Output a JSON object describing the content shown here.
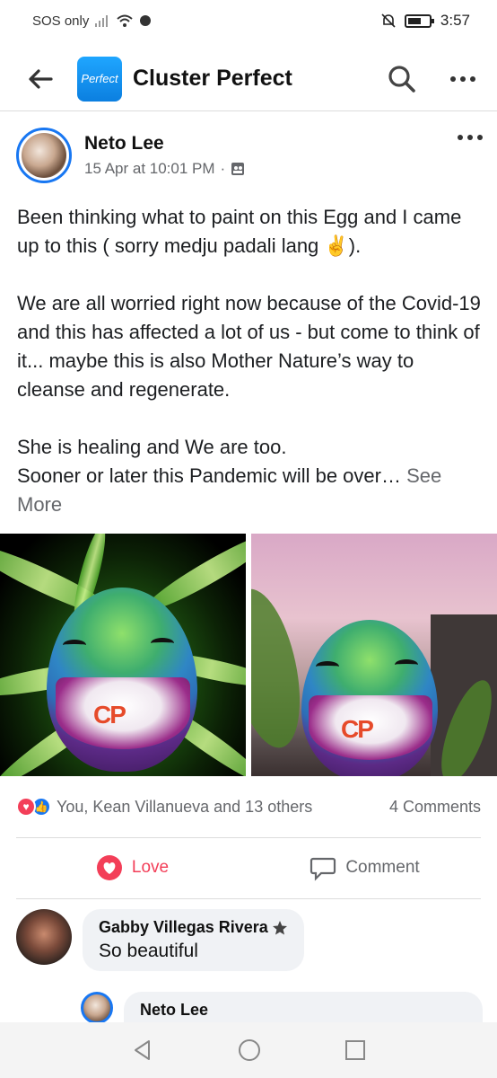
{
  "status_bar": {
    "carrier": "SOS only",
    "time": "3:57"
  },
  "app_bar": {
    "group_logo_text": "Perfect",
    "title": "Cluster Perfect"
  },
  "post": {
    "author": "Neto Lee",
    "timestamp": "15 Apr at 10:01 PM",
    "separator": "·",
    "paragraphs": [
      "Been thinking what to paint on this Egg and I came up to this ( sorry medju padali lang ✌️).",
      "We are all worried right now because of the Covid-19 and this has affected a lot of us - but come to think of it... maybe this is also Mother Nature’s way to cleanse and regenerate.",
      "She is healing and We are too.",
      "Sooner or later this Pandemic will be over…"
    ],
    "see_more": "See More",
    "photo_text": "CP"
  },
  "reactions": {
    "summary": "You, Kean Villanueva and 13 others",
    "comment_count": "4 Comments"
  },
  "actions": {
    "love_label": "Love",
    "comment_label": "Comment"
  },
  "comments": [
    {
      "author": "Gabby Villegas Rivera",
      "text": "So beautiful"
    },
    {
      "author": "Neto Lee",
      "text": ""
    }
  ],
  "colors": {
    "accent": "#1877f2",
    "love": "#f33e58",
    "muted": "#65676b"
  }
}
